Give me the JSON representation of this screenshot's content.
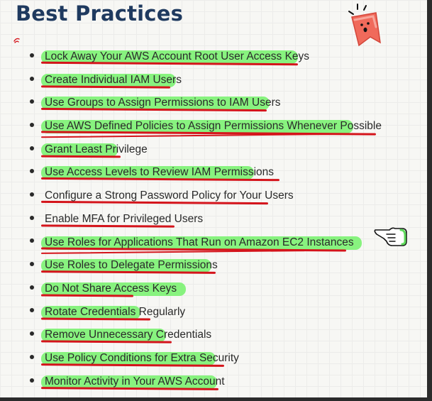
{
  "page": {
    "title": "Best Practices"
  },
  "practices": [
    {
      "label": "Lock Away Your AWS Account Root User Access Keys",
      "highlighted": true
    },
    {
      "label": "Create Individual IAM Users",
      "highlighted": true
    },
    {
      "label": "Use Groups to Assign Permissions to IAM Users",
      "highlighted": true
    },
    {
      "label": "Use AWS Defined Policies to Assign Permissions Whenever Possible",
      "highlighted": true
    },
    {
      "label": "Grant Least Privilege",
      "highlighted": true
    },
    {
      "label": "Use Access Levels to Review IAM Permissions",
      "highlighted": true
    },
    {
      "label": "Configure a Strong Password Policy for Your Users",
      "highlighted": false
    },
    {
      "label": "Enable MFA for Privileged Users",
      "highlighted": false
    },
    {
      "label": "Use Roles for Applications That Run on Amazon EC2 Instances",
      "highlighted": true
    },
    {
      "label": "Use Roles to Delegate Permissions",
      "highlighted": true
    },
    {
      "label": "Do Not Share Access Keys",
      "highlighted": true
    },
    {
      "label": "Rotate Credentials Regularly",
      "highlighted": true
    },
    {
      "label": "Remove Unnecessary Credentials",
      "highlighted": true
    },
    {
      "label": "Use Policy Conditions for Extra Security",
      "highlighted": true
    },
    {
      "label": "Monitor Activity in Your AWS Account",
      "highlighted": true
    }
  ],
  "colors": {
    "title": "#1f3a5f",
    "highlight": "#74f26a",
    "underline": "#d4141b",
    "sticker": "#f06a5b"
  },
  "icons": {
    "sticker": "surprised-face-sticker-icon",
    "hand": "pointing-hand-icon",
    "tick": "red-tick-icon"
  }
}
